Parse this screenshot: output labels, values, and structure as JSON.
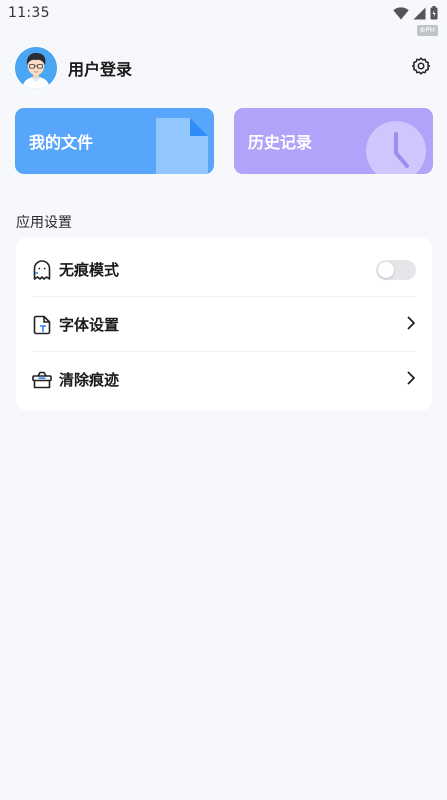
{
  "status_bar": {
    "time": "11:35",
    "badge": "⊕PH",
    "icons": [
      "wifi-icon",
      "cell-signal-icon",
      "battery-icon"
    ]
  },
  "header": {
    "avatar": "avatar",
    "login_label": "用户登录",
    "settings_icon": "gear-icon"
  },
  "cards": {
    "files": {
      "label": "我的文件",
      "icon": "document-icon",
      "color": "#57a6fb"
    },
    "history": {
      "label": "历史记录",
      "icon": "clock-icon",
      "color": "#b0a3f9"
    }
  },
  "section": {
    "title": "应用设置"
  },
  "settings": {
    "items": [
      {
        "label": "无痕模式",
        "icon": "ghost-icon",
        "control": "toggle",
        "enabled": false
      },
      {
        "label": "字体设置",
        "icon": "font-file-icon",
        "control": "chevron-right-icon"
      },
      {
        "label": "清除痕迹",
        "icon": "broom-box-icon",
        "control": "chevron-right-icon"
      }
    ]
  }
}
